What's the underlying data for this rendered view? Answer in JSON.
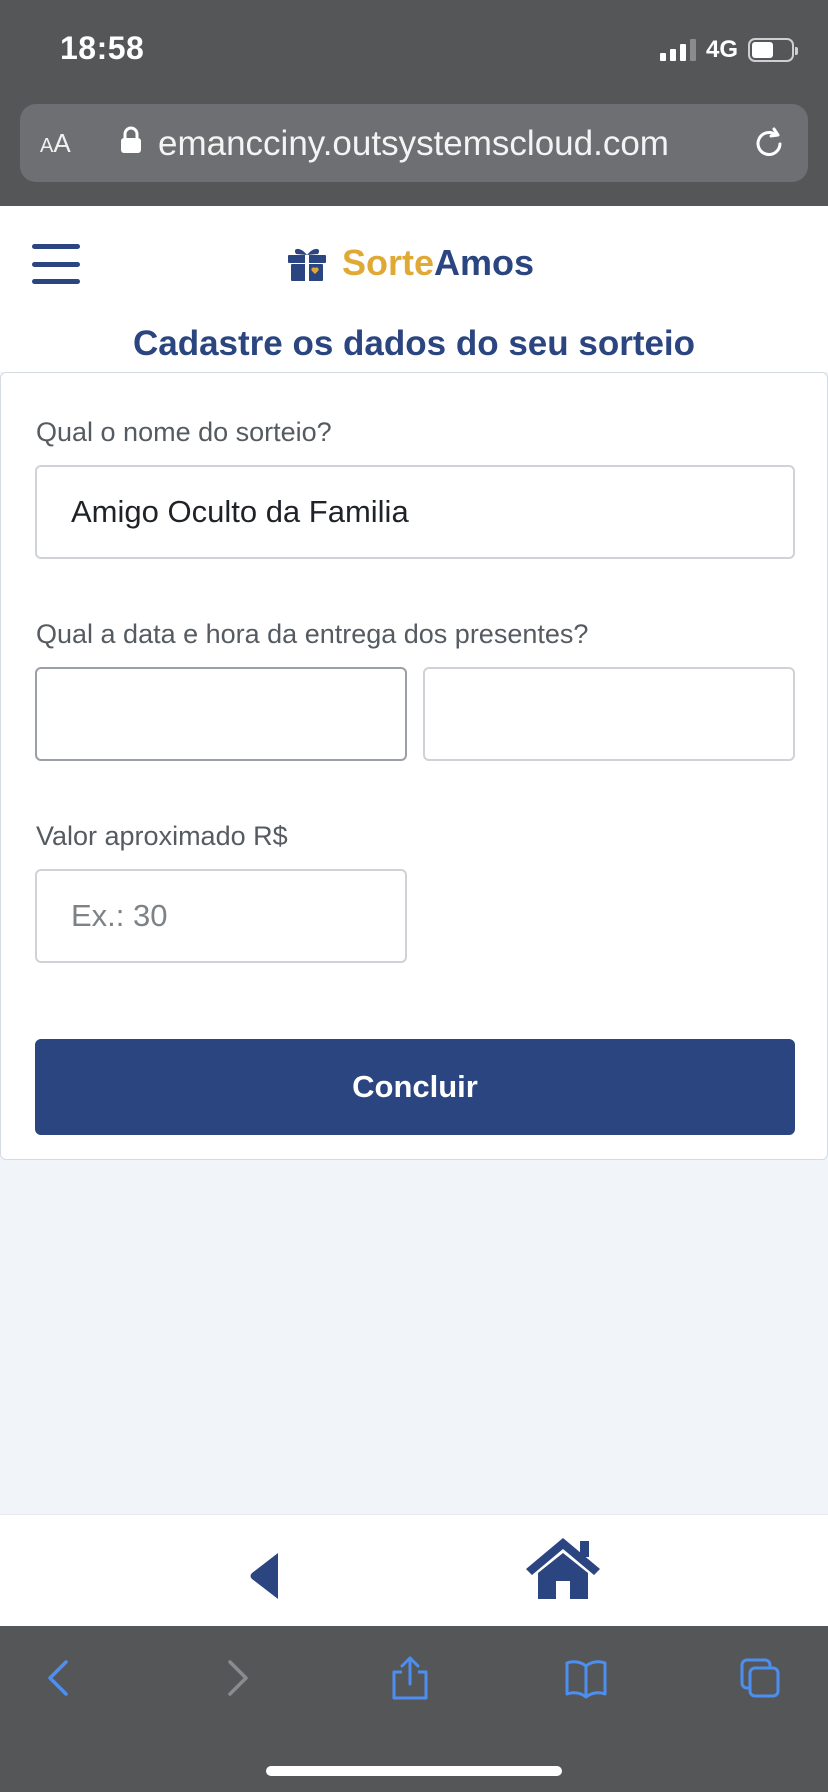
{
  "status": {
    "time": "18:58",
    "network": "4G"
  },
  "browser": {
    "text_size_small": "A",
    "text_size_large": "A",
    "url": "emancciny.outsystemscloud.com"
  },
  "brand": {
    "name_part1": "Sorte",
    "name_part2": "Amos",
    "primary_color": "#2a4580",
    "accent_color": "#e0a936"
  },
  "page": {
    "title": "Cadastre os dados do seu sorteio"
  },
  "form": {
    "name_label": "Qual o nome do sorteio?",
    "name_value": "Amigo Oculto da Familia",
    "date_label": "Qual a data e hora da entrega dos presentes?",
    "date_value": "",
    "time_value": "",
    "amount_label": "Valor aproximado R$",
    "amount_placeholder": "Ex.: 30",
    "submit_label": "Concluir"
  },
  "icons": {
    "menu": "hamburger-icon",
    "logo": "gift-icon",
    "back": "triangle-left-icon",
    "home": "house-icon"
  }
}
